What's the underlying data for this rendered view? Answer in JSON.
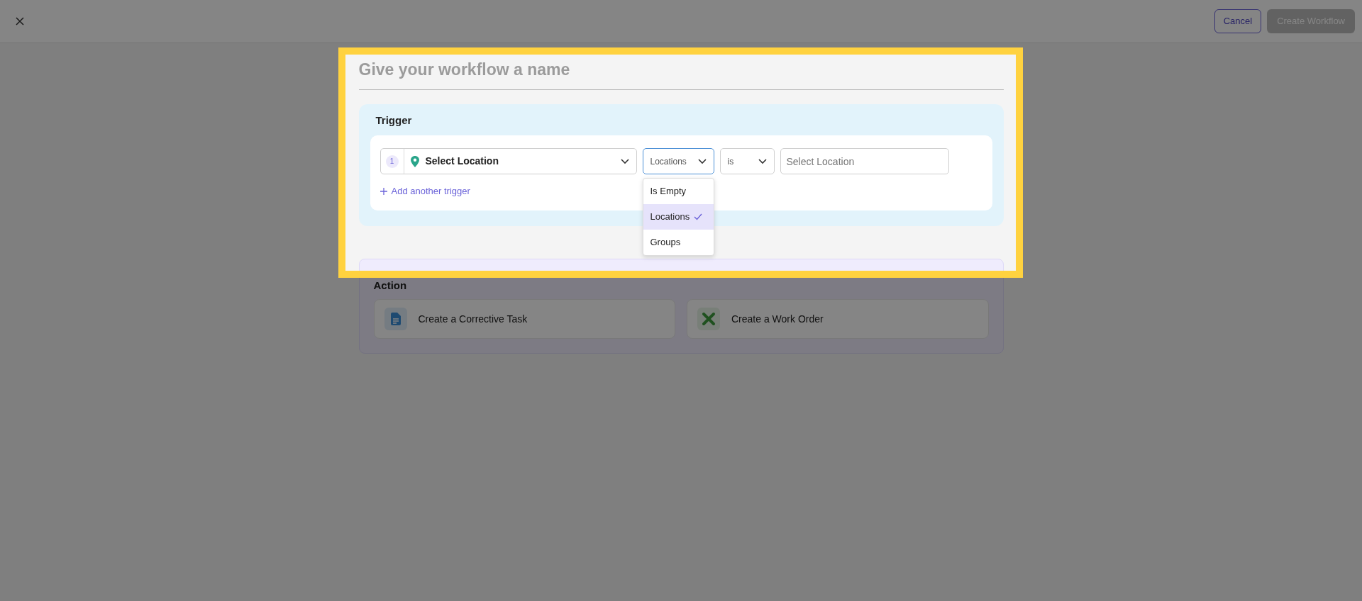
{
  "top_bar": {
    "buttons": [
      {
        "label": "Cancel",
        "kind": "outline",
        "disabled": false
      },
      {
        "label": "Create Workflow",
        "kind": "primary",
        "disabled": true
      }
    ]
  },
  "name_field": {
    "placeholder": "Give your workflow a name"
  },
  "trigger": {
    "title": "Trigger",
    "conditions": [
      {
        "number": "1",
        "field": "Select Location",
        "type_select": {
          "value": "Locations",
          "expanded": true,
          "options": [
            {
              "label": "Is Empty",
              "selected": false
            },
            {
              "label": "Locations",
              "selected": true
            },
            {
              "label": "Groups",
              "selected": false
            }
          ]
        },
        "operator": "is",
        "value_placeholder": "Select Location"
      }
    ],
    "add_link": "Add another trigger"
  },
  "action": {
    "title": "Action",
    "options": [
      {
        "label": "Create a Corrective Task",
        "kind": "task"
      },
      {
        "label": "Create a Work Order",
        "kind": "work_order"
      }
    ]
  }
}
